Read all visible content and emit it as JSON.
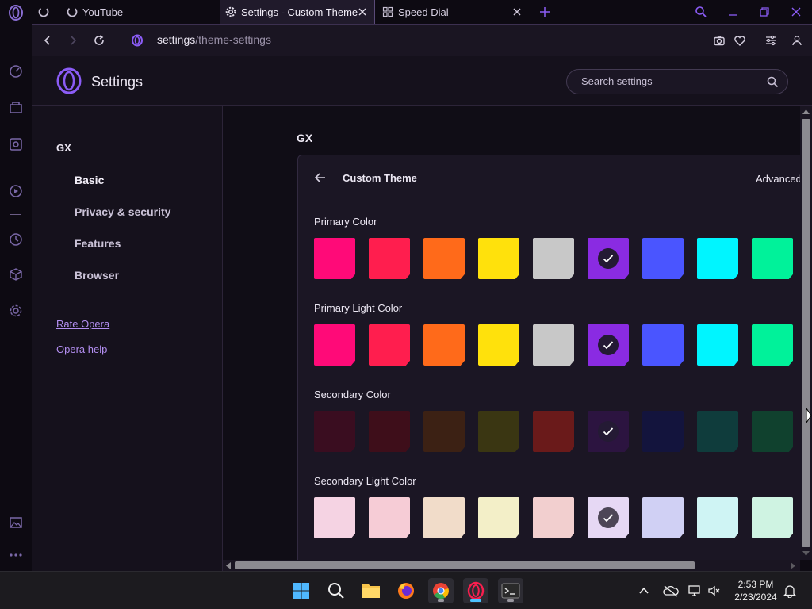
{
  "tabs": [
    {
      "label": "",
      "icon": "loading-icon"
    },
    {
      "label": "YouTube",
      "icon": "loading-icon"
    },
    {
      "label": "Settings - Custom Theme",
      "icon": "gear-icon",
      "active": true
    },
    {
      "label": "Speed Dial",
      "icon": "grid-icon"
    }
  ],
  "address": {
    "host": "settings",
    "path": "/theme-settings"
  },
  "header": {
    "title": "Settings",
    "search_placeholder": "Search settings"
  },
  "sidebar": {
    "section": "GX",
    "items": [
      "Basic",
      "Privacy & security",
      "Features",
      "Browser"
    ],
    "selected": "Basic",
    "links": [
      "Rate Opera",
      "Opera help"
    ]
  },
  "main": {
    "section": "GX",
    "card_title": "Custom Theme",
    "advanced_label": "Advanced",
    "groups": [
      {
        "label": "Primary Color",
        "selected": 5,
        "colors": [
          "#ff0a78",
          "#ff1e4e",
          "#ff6a1a",
          "#ffe10c",
          "#c8c8c8",
          "#8a2be2",
          "#4a55ff",
          "#00f5ff",
          "#00f29a"
        ]
      },
      {
        "label": "Primary Light Color",
        "selected": 5,
        "colors": [
          "#ff0a78",
          "#ff1e4e",
          "#ff6a1a",
          "#ffe10c",
          "#c8c8c8",
          "#8a2be2",
          "#4a55ff",
          "#00f5ff",
          "#00f29a"
        ]
      },
      {
        "label": "Secondary Color",
        "selected": 5,
        "colors": [
          "#3a0d20",
          "#3e0e1a",
          "#3c2114",
          "#3a3612",
          "#6a1a1a",
          "#2c1440",
          "#13143d",
          "#0f3c3c",
          "#10412e"
        ]
      },
      {
        "label": "Secondary Light Color",
        "selected": 5,
        "colors": [
          "#f5d3e3",
          "#f6ccd6",
          "#f1dcc9",
          "#f3efc8",
          "#f2cfcf",
          "#e6d8f4",
          "#d0d0f4",
          "#cff4f4",
          "#cff3e2"
        ]
      }
    ]
  },
  "taskbar": {
    "time": "2:53 PM",
    "date": "2/23/2024"
  },
  "colors": {
    "accent": "#8b2be2",
    "link": "#b28ef0",
    "background": "#100d16"
  }
}
